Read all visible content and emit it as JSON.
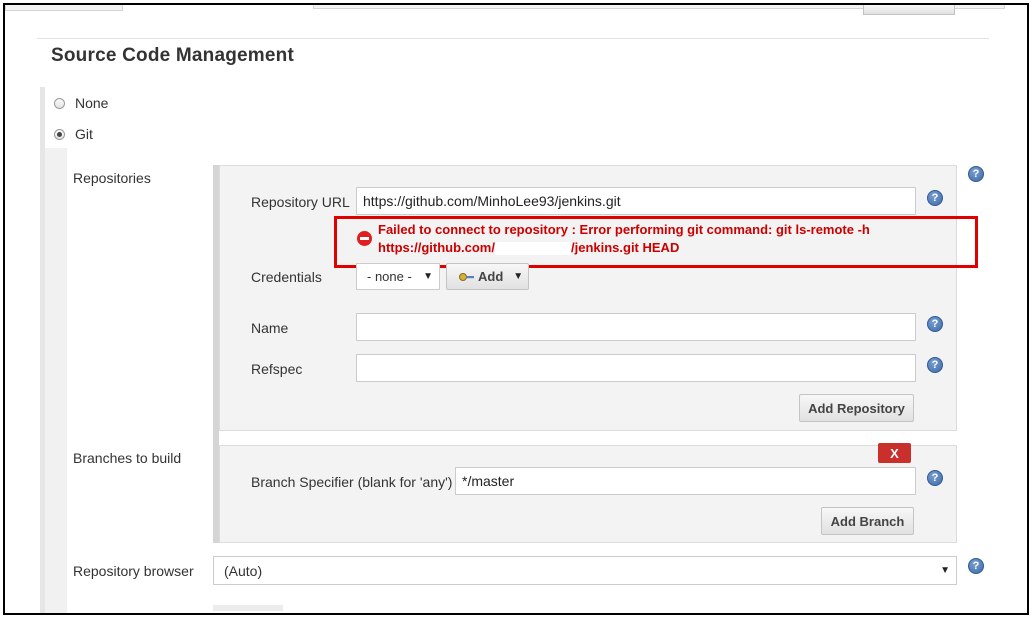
{
  "section": {
    "title": "Source Code Management"
  },
  "scm_options": {
    "none_label": "None",
    "git_label": "Git",
    "selected": "Git"
  },
  "repositories": {
    "label": "Repositories",
    "url_label": "Repository URL",
    "url_value": "https://github.com/MinhoLee93/jenkins.git",
    "error_line1": "Failed to connect to repository : Error performing git command: git ls-remote -h",
    "error_line2_prefix": "https://github.com/",
    "error_line2_suffix": "/jenkins.git HEAD",
    "credentials_label": "Credentials",
    "credentials_value": "- none -",
    "add_label": "Add",
    "name_label": "Name",
    "name_value": "",
    "refspec_label": "Refspec",
    "refspec_value": "",
    "add_repository_label": "Add Repository"
  },
  "branches": {
    "label": "Branches to build",
    "delete_label": "X",
    "specifier_label": "Branch Specifier (blank for 'any')",
    "specifier_value": "*/master",
    "add_branch_label": "Add Branch"
  },
  "repository_browser": {
    "label": "Repository browser",
    "value": "(Auto)"
  },
  "help_glyph": "?",
  "icons": {
    "help": "help-icon",
    "error": "error-icon",
    "key": "key-icon",
    "caret": "caret-down-icon"
  },
  "colors": {
    "error_red": "#cc0000",
    "highlight_border": "#e00000",
    "help_blue": "#3d6aa8",
    "delete_red": "#c9302c"
  }
}
